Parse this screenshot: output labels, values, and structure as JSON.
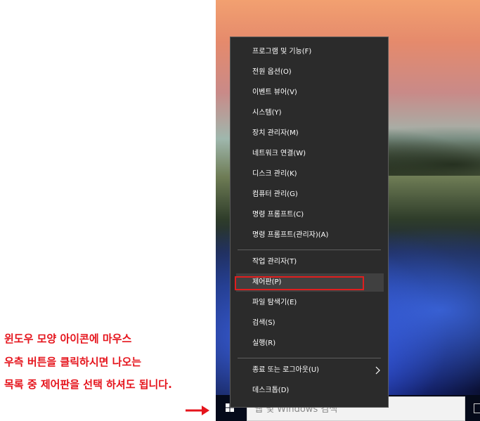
{
  "annotation": {
    "lines": [
      "윈도우 모양 아이콘에 마우스",
      "우측 버튼을 클릭하시면 나오는",
      "목록 중 제어판을 선택 하셔도 됩니다."
    ],
    "color": "#e5141c"
  },
  "context_menu": {
    "items": [
      {
        "label": "프로그램 및 기능(F)"
      },
      {
        "label": "전원 옵션(O)"
      },
      {
        "label": "이벤트 뷰어(V)"
      },
      {
        "label": "시스템(Y)"
      },
      {
        "label": "장치 관리자(M)"
      },
      {
        "label": "네트워크 연결(W)"
      },
      {
        "label": "디스크 관리(K)"
      },
      {
        "label": "컴퓨터 관리(G)"
      },
      {
        "label": "명령 프롬프트(C)"
      },
      {
        "label": "명령 프롬프트(관리자)(A)"
      },
      {
        "label": "작업 관리자(T)"
      },
      {
        "label": "제어판(P)",
        "highlighted": true
      },
      {
        "label": "파일 탐색기(E)"
      },
      {
        "label": "검색(S)"
      },
      {
        "label": "실행(R)"
      },
      {
        "label": "종료 또는 로그아웃(U)",
        "has_submenu": true
      },
      {
        "label": "데스크톱(D)"
      }
    ]
  },
  "taskbar": {
    "search_placeholder": "웹 및 Windows 검색",
    "start_icon": "windows-logo-icon"
  },
  "colors": {
    "menu_bg": "#2b2b2b",
    "highlight_box": "#e01e1e",
    "annotation_text": "#e5141c"
  }
}
